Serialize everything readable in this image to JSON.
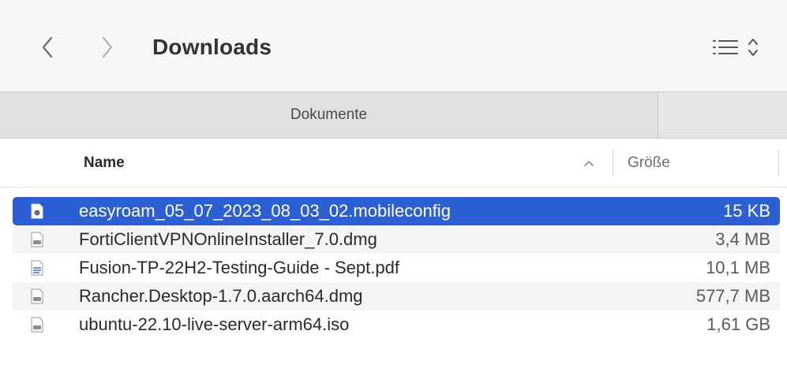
{
  "toolbar": {
    "title": "Downloads",
    "back_icon": "chevron-left-icon",
    "forward_icon": "chevron-right-icon",
    "view_icon": "list-view-icon",
    "sort_icon": "up-down-chevron-icon"
  },
  "tabs": [
    {
      "label": "Dokumente"
    }
  ],
  "columns": {
    "name": "Name",
    "size": "Größe",
    "sort_indicator_icon": "chevron-up-icon"
  },
  "files": [
    {
      "name": "easyroam_05_07_2023_08_03_02.mobileconfig",
      "size": "15 KB",
      "selected": true,
      "icon": "config-file-icon"
    },
    {
      "name": "FortiClientVPNOnlineInstaller_7.0.dmg",
      "size": "3,4 MB",
      "selected": false,
      "icon": "disk-image-icon"
    },
    {
      "name": "Fusion-TP-22H2-Testing-Guide - Sept.pdf",
      "size": "10,1 MB",
      "selected": false,
      "icon": "pdf-file-icon"
    },
    {
      "name": "Rancher.Desktop-1.7.0.aarch64.dmg",
      "size": "577,7 MB",
      "selected": false,
      "icon": "disk-image-icon"
    },
    {
      "name": "ubuntu-22.10-live-server-arm64.iso",
      "size": "1,61 GB",
      "selected": false,
      "icon": "disk-image-icon"
    }
  ],
  "colors": {
    "selection": "#2d5fd4",
    "toolbar_bg": "#f6f6f6",
    "tab_bg": "#e0e0e0"
  }
}
